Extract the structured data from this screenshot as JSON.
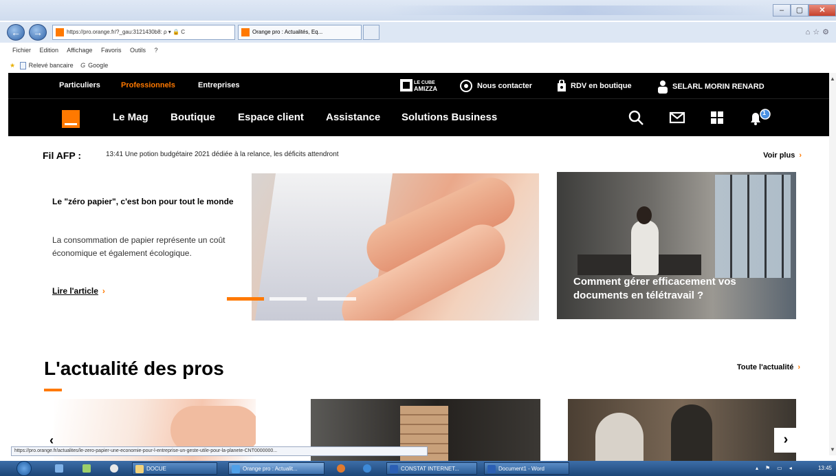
{
  "browser": {
    "address": "https://pro.orange.fr/?_gau:3121430b8: ρ ▾ 🔒 C",
    "tab_title": "Orange pro : Actualités, Eq...",
    "menu": [
      "Fichier",
      "Edition",
      "Affichage",
      "Favoris",
      "Outils",
      "?"
    ],
    "favorites": [
      "Relevé bancaire",
      "Google"
    ],
    "status_url": "https://pro.orange.fr/actualites/le-zero-papier-une-economie-pour-l-entreprise-un-geste-utile-pour-la-planete-CNT0000000..."
  },
  "orange": {
    "segments": [
      "Particuliers",
      "Professionnels",
      "Entreprises"
    ],
    "active_segment": "Professionnels",
    "cube_label": "LE CUBE\nAMIZZA",
    "contact": "Nous contacter",
    "rdv": "RDV en boutique",
    "account": "SELARL MORIN RENARD",
    "nav": [
      "Le Mag",
      "Boutique",
      "Espace client",
      "Assistance",
      "Solutions Business"
    ],
    "notif_count": "1",
    "brand_color": "#ff7900"
  },
  "afp": {
    "label": "Fil AFP :",
    "text": "13:41  Une potion budgétaire 2021 dédiée à la relance, les déficits attendront",
    "more": "Voir plus"
  },
  "hero": {
    "title": "Le \"zéro papier\", c'est bon pour tout le monde",
    "desc": "La consommation de papier représente un coût économique et également écologique.",
    "link": "Lire l'article"
  },
  "side": {
    "caption": "Comment gérer efficacement vos documents en télétravail ?"
  },
  "news": {
    "title": "L'actualité des pros",
    "all": "Toute l'actualité"
  },
  "taskbar": {
    "items": [
      "DOCUE",
      "Orange pro : Actualit...",
      "CONSTAT INTERNET...",
      "Document1 - Word"
    ],
    "time": "13:45"
  }
}
